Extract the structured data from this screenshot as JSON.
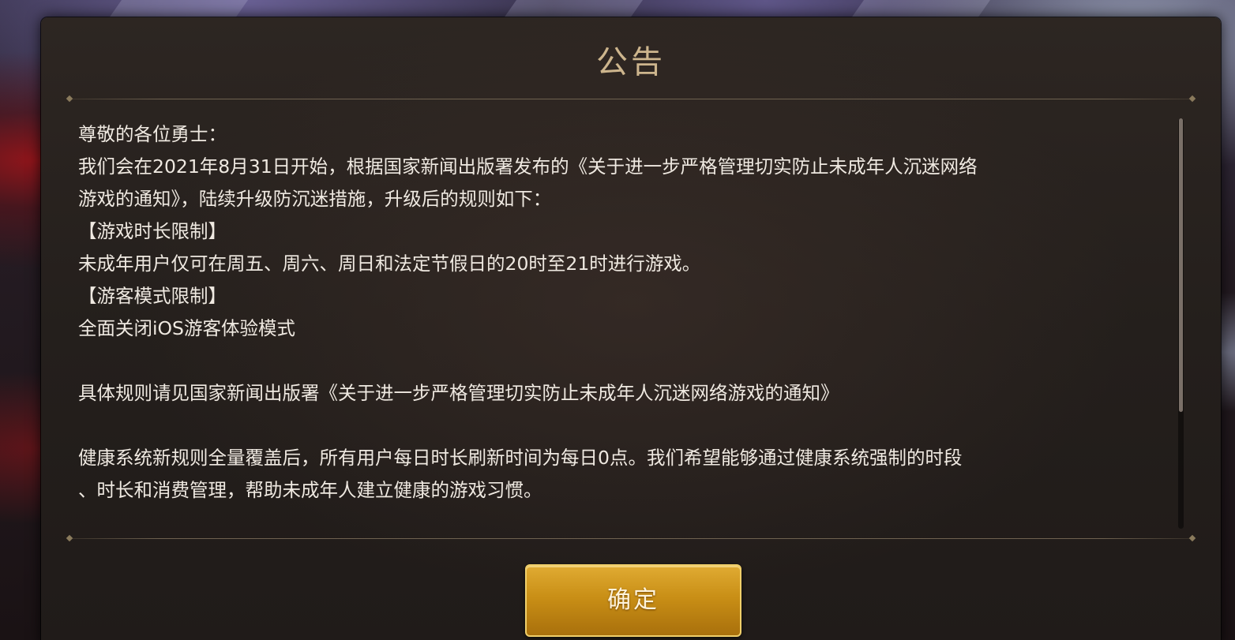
{
  "dialog": {
    "title": "公告",
    "confirm_label": "确定"
  },
  "notice": {
    "lines": [
      "尊敬的各位勇士：",
      "我们会在2021年8月31日开始，根据国家新闻出版署发布的《关于进一步严格管理切实防止未成年人沉迷网络",
      "游戏的通知》，陆续升级防沉迷措施，升级后的规则如下：",
      "【游戏时长限制】",
      "未成年用户仅可在周五、周六、周日和法定节假日的20时至21时进行游戏。",
      "【游客模式限制】",
      "全面关闭iOS游客体验模式",
      "",
      "具体规则请见国家新闻出版署《关于进一步严格管理切实防止未成年人沉迷网络游戏的通知》",
      "",
      "健康系统新规则全量覆盖后，所有用户每日时长刷新时间为每日0点。我们希望能够通过健康系统强制的时段",
      "、时长和消费管理，帮助未成年人建立健康的游戏习惯。"
    ]
  }
}
